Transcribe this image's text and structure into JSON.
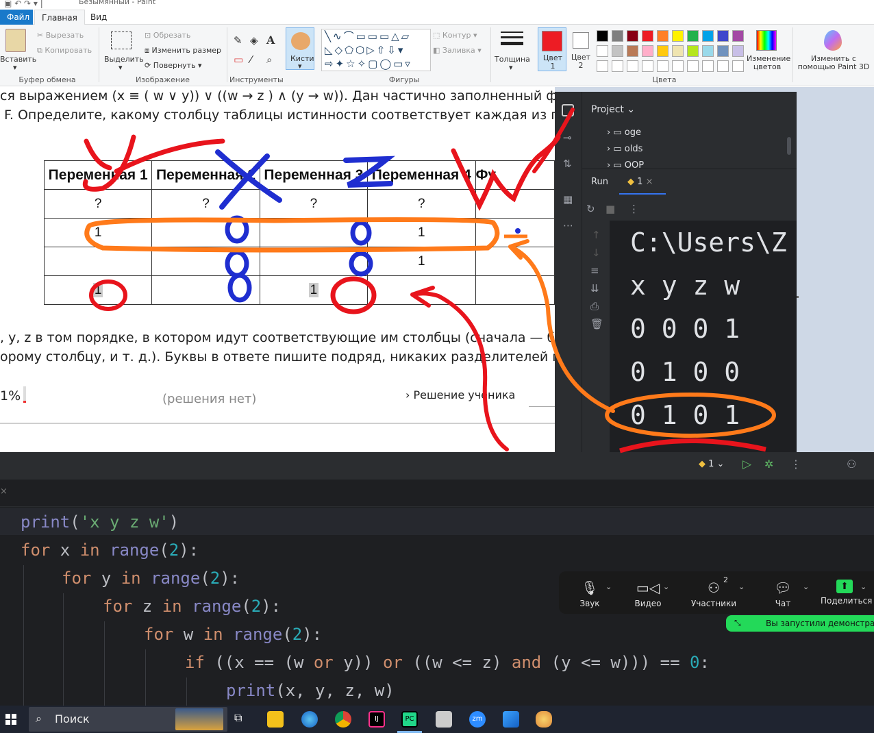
{
  "paint": {
    "title": "Безымянный - Paint",
    "tabs": [
      "Файл",
      "Главная",
      "Вид"
    ],
    "clipboard": {
      "paste": "Вставить",
      "cut": "Вырезать",
      "copy": "Копировать",
      "label": "Буфер обмена"
    },
    "image": {
      "select": "Выделить",
      "crop": "Обрезать",
      "resize": "Изменить размер",
      "rotate": "Повернуть",
      "label": "Изображение"
    },
    "tools": {
      "label": "Инструменты"
    },
    "brushes": {
      "label": "Кисти"
    },
    "shapes": {
      "outline": "Контур",
      "fill": "Заливка",
      "label": "Фигуры"
    },
    "thickness": "Толщина",
    "color1": "Цвет 1",
    "color2": "Цвет 2",
    "colors_label": "Цвета",
    "edit_colors": "Изменение цветов",
    "paint3d": "Изменить с помощью Paint 3D",
    "palette": [
      "#000000",
      "#7f7f7f",
      "#880015",
      "#ed1c24",
      "#ff7f27",
      "#fff200",
      "#22b14c",
      "#00a2e8",
      "#3f48cc",
      "#a349a4",
      "#ffffff",
      "#c3c3c3",
      "#b97a57",
      "#ffaec9",
      "#ffc90e",
      "#efe4b0",
      "#b5e61d",
      "#99d9ea",
      "#7092be",
      "#c8bfe7"
    ]
  },
  "doc": {
    "line1": "ся выражением (x ≡ ( w ∨ y)) ∨ ((w → z ) ∧ (y → w)). Дан частично заполненный фрагм",
    "line2": "F. Определите, какому столбцу таблицы истинности соответствует каждая из пере",
    "headers": [
      "Переменная 1",
      "Переменная 2",
      "Переменная 3",
      "Переменная 4",
      "Фу"
    ],
    "rows": [
      [
        "?",
        "?",
        "?",
        "?"
      ],
      [
        "1",
        "",
        "",
        "1"
      ],
      [
        "",
        "",
        "",
        "1"
      ],
      [
        "1",
        "",
        "1",
        ""
      ]
    ],
    "line3": ", y, z в том порядке, в котором идут соответствующие им столбцы (сначала  — букв",
    "line4": "орому столбцу, и т. д.). Буквы в ответе пишите подряд, никаких разделителей меж",
    "percent": "1%",
    "no_solutions": "(решения нет)",
    "student_solution": "Решение ученика"
  },
  "pycharm": {
    "project_label": "Project",
    "tree": [
      "oge",
      "olds",
      "OOP"
    ],
    "run_label": "Run",
    "run_tab": "1",
    "console": [
      "C:\\Users\\Z",
      "x y z w",
      "0 0 0 1",
      "0 1 0 0",
      "0 1 0 1"
    ],
    "run_config": "1",
    "code": [
      "print('x y z w')",
      "for x in range(2):",
      "for y in range(2):",
      "for z in range(2):",
      "for w in range(2):",
      "if ((x == (w or y)) or ((w <= z) and (y <= w))) == 0:",
      "print(x, y, z, w)"
    ]
  },
  "zoom": {
    "audio": "Звук",
    "video": "Видео",
    "participants": "Участники",
    "participants_count": "2",
    "chat": "Чат",
    "share": "Поделиться",
    "banner": "Вы запустили демонстраци"
  },
  "taskbar": {
    "search": "Поиск"
  },
  "annotations": {
    "y": "y",
    "x": "x",
    "z": "z",
    "w": "w"
  }
}
